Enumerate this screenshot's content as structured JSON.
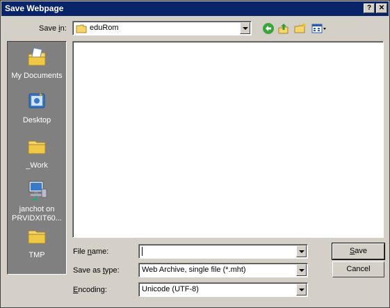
{
  "window": {
    "title": "Save Webpage"
  },
  "titlebar": {
    "help_label": "?",
    "close_label": "✕"
  },
  "save_in": {
    "label_pre": "Save ",
    "label_u": "i",
    "label_post": "n:",
    "value": "eduRom"
  },
  "toolbar": {
    "icons": [
      "back-icon",
      "up-folder-icon",
      "new-folder-icon",
      "views-menu-icon"
    ]
  },
  "places": [
    {
      "label": "My Documents",
      "icon": "my-documents-icon"
    },
    {
      "label": "Desktop",
      "icon": "desktop-icon"
    },
    {
      "label": "_Work",
      "icon": "folder-icon"
    },
    {
      "label": "janchot on PRVIDXIT60...",
      "icon": "network-drive-icon"
    },
    {
      "label": "TMP",
      "icon": "folder-icon"
    }
  ],
  "filename": {
    "label_pre": "File ",
    "label_u": "n",
    "label_post": "ame:",
    "value": ""
  },
  "saveastype": {
    "label_pre": "Save as ",
    "label_u": "t",
    "label_post": "ype:",
    "value": "Web Archive, single file (*.mht)"
  },
  "encoding": {
    "label_u": "E",
    "label_post": "ncoding:",
    "value": "Unicode (UTF-8)"
  },
  "buttons": {
    "save_u": "S",
    "save_post": "ave",
    "cancel": "Cancel"
  },
  "colors": {
    "titlebar": "#0a246a",
    "face": "#d4d0c8",
    "places_bg": "#808080"
  }
}
